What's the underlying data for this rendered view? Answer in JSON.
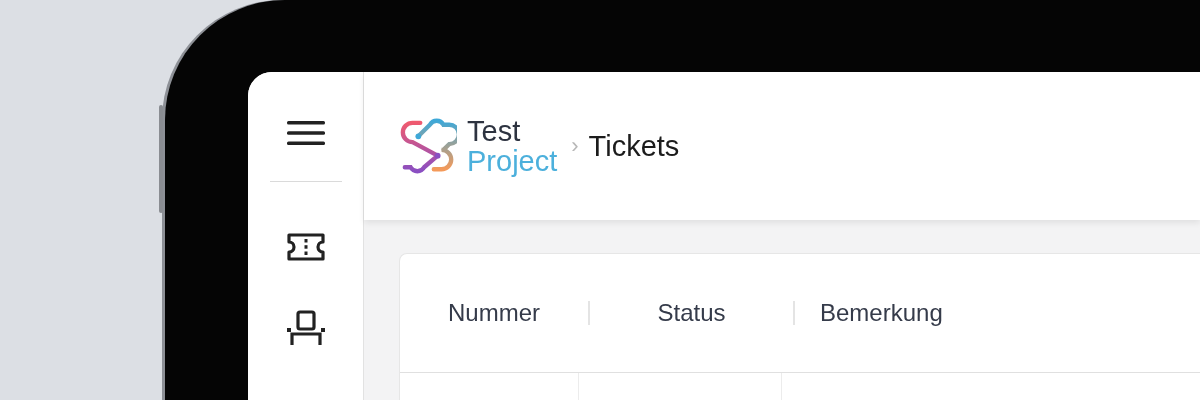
{
  "header": {
    "logo": {
      "line_1": "Test",
      "line_2": "Project"
    },
    "breadcrumb_separator": "›",
    "page_title": "Tickets"
  },
  "table": {
    "columns": [
      "Nummer",
      "Status",
      "Bemerkung"
    ]
  }
}
